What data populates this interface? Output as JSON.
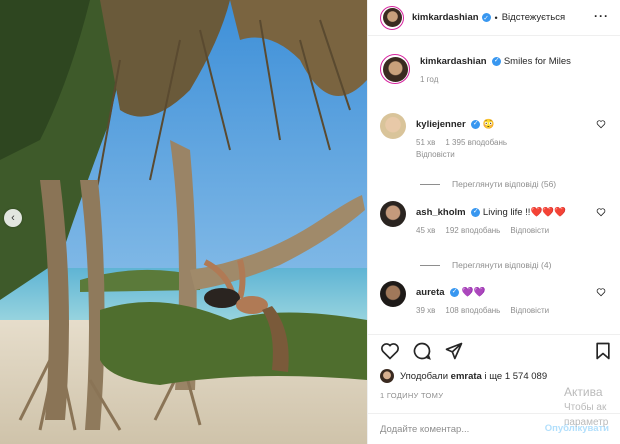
{
  "post": {
    "username": "kimkardashian",
    "follow_status": "Відстежується",
    "caption": "Smiles for Miles",
    "posted_ago": "1 год"
  },
  "comments": [
    {
      "username": "kyliejenner",
      "text": "😳",
      "time": "51 хв",
      "likes": "1 395 вподобань",
      "reply_label": "Відповісти",
      "view_replies": "Переглянути відповіді (56)"
    },
    {
      "username": "ash_kholm",
      "text": "Living life !!❤️❤️❤️",
      "time": "45 хв",
      "likes": "192 вподобань",
      "reply_label": "Відповісти",
      "view_replies": "Переглянути відповіді (4)"
    },
    {
      "username": "aureta",
      "text": "💜💜",
      "time": "39 хв",
      "likes": "108 вподобань",
      "reply_label": "Відповісти"
    }
  ],
  "likes_summary": {
    "prefix": "Уподобали",
    "user": "emrata",
    "suffix": "і ще 1 574 089"
  },
  "post_time": "1 ГОДИНУ ТОМУ",
  "comment_box": {
    "placeholder": "Додайте коментар...",
    "publish_label": "Опублікувати"
  },
  "watermark": {
    "line1": "Актива",
    "line2": "Чтобы ак",
    "line3": "параметр"
  },
  "icons": {
    "like": "heart-icon",
    "comment": "comment-icon",
    "share": "share-icon",
    "save": "bookmark-icon",
    "more": "more-options-icon",
    "carousel": "chevron-left-icon"
  },
  "colors": {
    "verified": "#3897f0",
    "story_ring": "#d6249f",
    "secondary_text": "#8e8e8e",
    "publish_disabled": "#b2dffc"
  }
}
